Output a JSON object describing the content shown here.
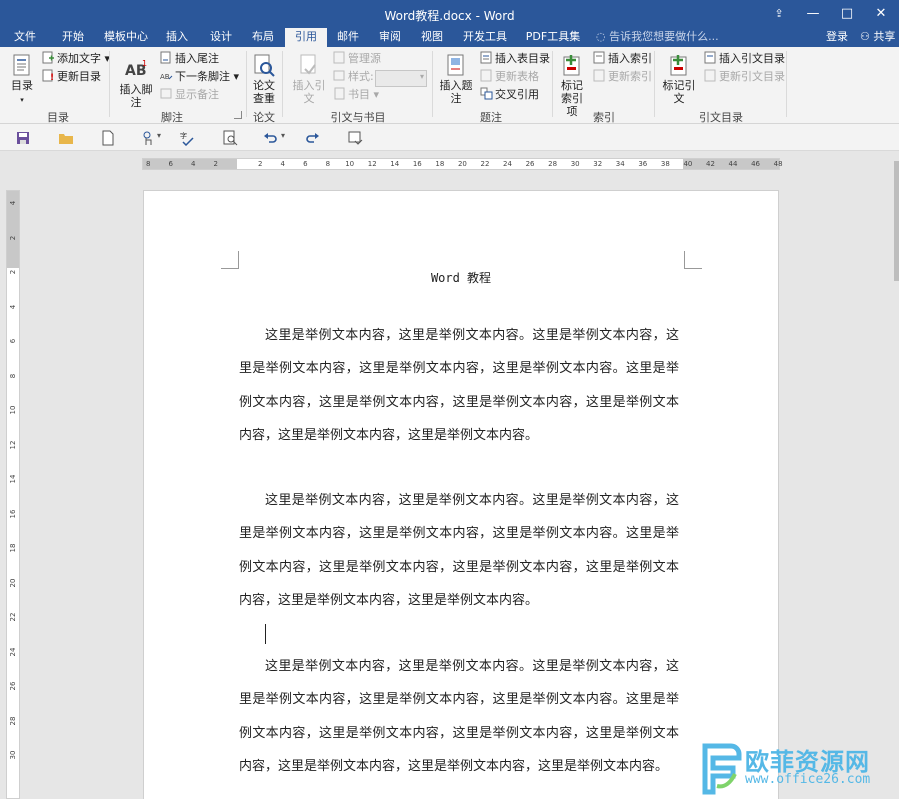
{
  "window": {
    "title": "Word教程.docx - Word",
    "controls": {
      "ribbon_display": "⇪",
      "minimize": "—",
      "maximize": "□",
      "close": "✕"
    }
  },
  "tabs": [
    "文件",
    "开始",
    "模板中心",
    "插入",
    "设计",
    "布局",
    "引用",
    "邮件",
    "审阅",
    "视图",
    "开发工具",
    "PDF工具集"
  ],
  "active_tab": "引用",
  "tell_me": "告诉我您想要做什么...",
  "account": {
    "login": "登录",
    "share": "共享"
  },
  "ribbon": {
    "toc": {
      "big": "目录",
      "add_text": "添加文字",
      "update": "更新目录",
      "label": "目录"
    },
    "footnotes": {
      "insert_footnote": "插入脚注",
      "insert_endnote": "插入尾注",
      "next_footnote": "下一条脚注",
      "show_notes": "显示备注",
      "label": "脚注"
    },
    "research": {
      "big": "论文查重",
      "label": "论文"
    },
    "citations": {
      "insert_citation": "插入引文",
      "manage_sources": "管理源",
      "style": "样式:",
      "bibliography": "书目",
      "label": "引文与书目"
    },
    "captions": {
      "insert_caption": "插入题注",
      "insert_table_of_figures": "插入表目录",
      "update_table": "更新表格",
      "cross_reference": "交叉引用",
      "label": "题注"
    },
    "index": {
      "mark_entry": "标记索引项",
      "insert_index": "插入索引",
      "update_index": "更新索引",
      "label": "索引"
    },
    "toa": {
      "mark_citation": "标记引文",
      "insert_toa": "插入引文目录",
      "update_toa": "更新引文目录",
      "label": "引文目录"
    }
  },
  "ruler": {
    "h_left": [
      "8",
      "6",
      "4",
      "2"
    ],
    "h_main": [
      "2",
      "4",
      "6",
      "8",
      "10",
      "12",
      "14",
      "16",
      "18",
      "20",
      "22",
      "24",
      "26",
      "28",
      "30",
      "32",
      "34",
      "36",
      "38",
      "40",
      "42",
      "44",
      "46",
      "48"
    ],
    "v": [
      "4",
      "2",
      "2",
      "4",
      "6",
      "8",
      "10",
      "12",
      "14",
      "16",
      "18",
      "20",
      "22",
      "24",
      "26",
      "28",
      "30"
    ]
  },
  "document": {
    "header": "Word 教程",
    "paragraphs": [
      "这里是举例文本内容，这里是举例文本内容。这里是举例文本内容，这里是举例文本内容，这里是举例文本内容，这里是举例文本内容。这里是举例文本内容，这里是举例文本内容，这里是举例文本内容，这里是举例文本内容，这里是举例文本内容，这里是举例文本内容。",
      "这里是举例文本内容，这里是举例文本内容。这里是举例文本内容，这里是举例文本内容，这里是举例文本内容，这里是举例文本内容。这里是举例文本内容，这里是举例文本内容，这里是举例文本内容，这里是举例文本内容，这里是举例文本内容，这里是举例文本内容。",
      "这里是举例文本内容，这里是举例文本内容。这里是举例文本内容，这里是举例文本内容，这里是举例文本内容，这里是举例文本内容。这里是举例文本内容，这里是举例文本内容，这里是举例文本内容，这里是举例文本内容，这里是举例文本内容，这里是举例文本内容，这里是举例文本内容。"
    ]
  },
  "watermark": {
    "name": "欧菲资源网",
    "url": "www.office26.com"
  },
  "colors": {
    "word_blue": "#2b579a",
    "ribbon_bg": "#f3f3f3",
    "watermark": "#55b8e6"
  }
}
